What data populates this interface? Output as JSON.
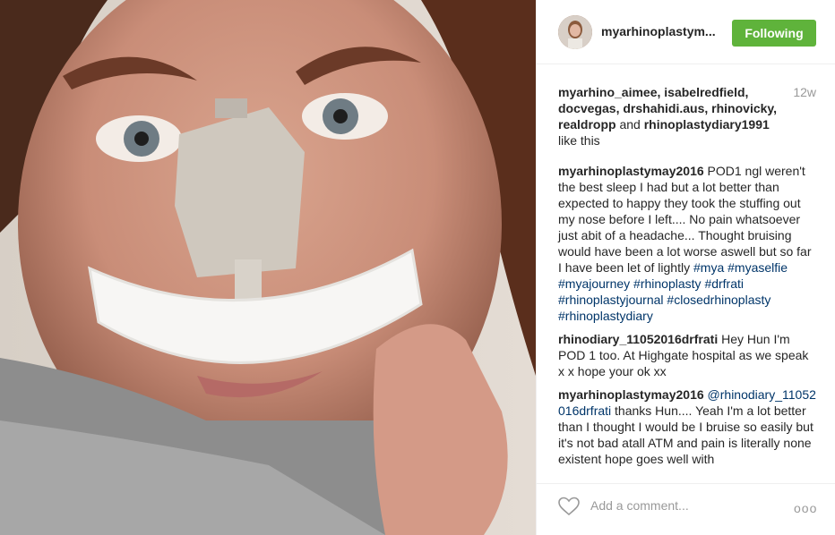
{
  "header": {
    "username": "myarhinoplastym...",
    "follow_label": "Following"
  },
  "likes": {
    "names": "myarhino_aimee, isabelredfield, docvegas, drshahidi.aus, rhinovicky, realdropp",
    "and_text": "and",
    "last_name": "rhinoplastydiary1991",
    "tail": "like this",
    "age": "12w"
  },
  "caption": {
    "user": "myarhinoplastymay2016",
    "text": "POD1 ngl weren't the best sleep I had but a lot better than expected to happy they took the stuffing out my nose before I left.... No pain whatsoever just abit of a headache... Thought bruising would have been a lot worse aswell but so far I have been let of lightly",
    "tags": [
      "#mya",
      "#myaselfie",
      "#myajourney",
      "#rhinoplasty",
      "#drfrati",
      "#rhinoplastyjournal",
      "#closedrhinoplasty",
      "#rhinoplastydiary"
    ]
  },
  "comments": [
    {
      "user": "rhinodiary_11052016drfrati",
      "text": "Hey Hun I'm POD 1 too. At Highgate hospital as we speak x x hope your ok xx"
    },
    {
      "user": "myarhinoplastymay2016",
      "mention": "@rhinodiary_11052016drfrati",
      "text": "thanks Hun.... Yeah I'm a lot better than I thought I would be I bruise so easily but it's not bad atall ATM and pain is literally none existent hope goes well with"
    }
  ],
  "footer": {
    "add_comment_placeholder": "Add a comment...",
    "more_label": "ooo",
    "heart_icon": "heart-outline-icon"
  },
  "colors": {
    "follow_bg": "#5fb33b",
    "hashtag": "#003569",
    "muted": "#999999"
  }
}
